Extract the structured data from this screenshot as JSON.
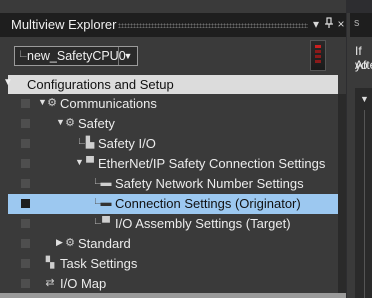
{
  "window": {
    "title": "Multiview Explorer",
    "pin_glyph": "⊼",
    "close_glyph": "×"
  },
  "toolbar": {
    "device_selector_value": "new_SafetyCPU0",
    "dropdown_arrow": "▼"
  },
  "section": {
    "title": "Configurations and Setup",
    "arrow": "▼"
  },
  "tree": {
    "items": [
      {
        "label": "Communications",
        "expander": "▼",
        "icon": "communications-icon"
      },
      {
        "label": "Safety",
        "expander": "▼",
        "icon": "safety-icon"
      },
      {
        "label": "Safety I/O",
        "expander": "",
        "icon": "safety-io-icon"
      },
      {
        "label": "EtherNet/IP Safety Connection Settings",
        "expander": "▼",
        "icon": "network-icon"
      },
      {
        "label": "Safety Network Number Settings",
        "expander": "",
        "icon": "network-number-icon"
      },
      {
        "label": "Connection Settings (Originator)",
        "expander": "",
        "icon": "connection-icon",
        "selected": true
      },
      {
        "label": "I/O Assembly Settings (Target)",
        "expander": "",
        "icon": "assembly-icon"
      },
      {
        "label": "Standard",
        "expander": "▶",
        "icon": "standard-icon"
      },
      {
        "label": "Task Settings",
        "expander": "",
        "icon": "task-icon"
      },
      {
        "label": "I/O Map",
        "expander": "",
        "icon": "io-map-icon"
      }
    ]
  },
  "side_panel": {
    "tab_label": "s",
    "line1": "If yo",
    "line2": "Afte",
    "expander": "▼"
  },
  "colors": {
    "selection": "#9cc8f0",
    "header_bg": "#dcdcdc",
    "panel_bg": "#3a3a3a"
  }
}
